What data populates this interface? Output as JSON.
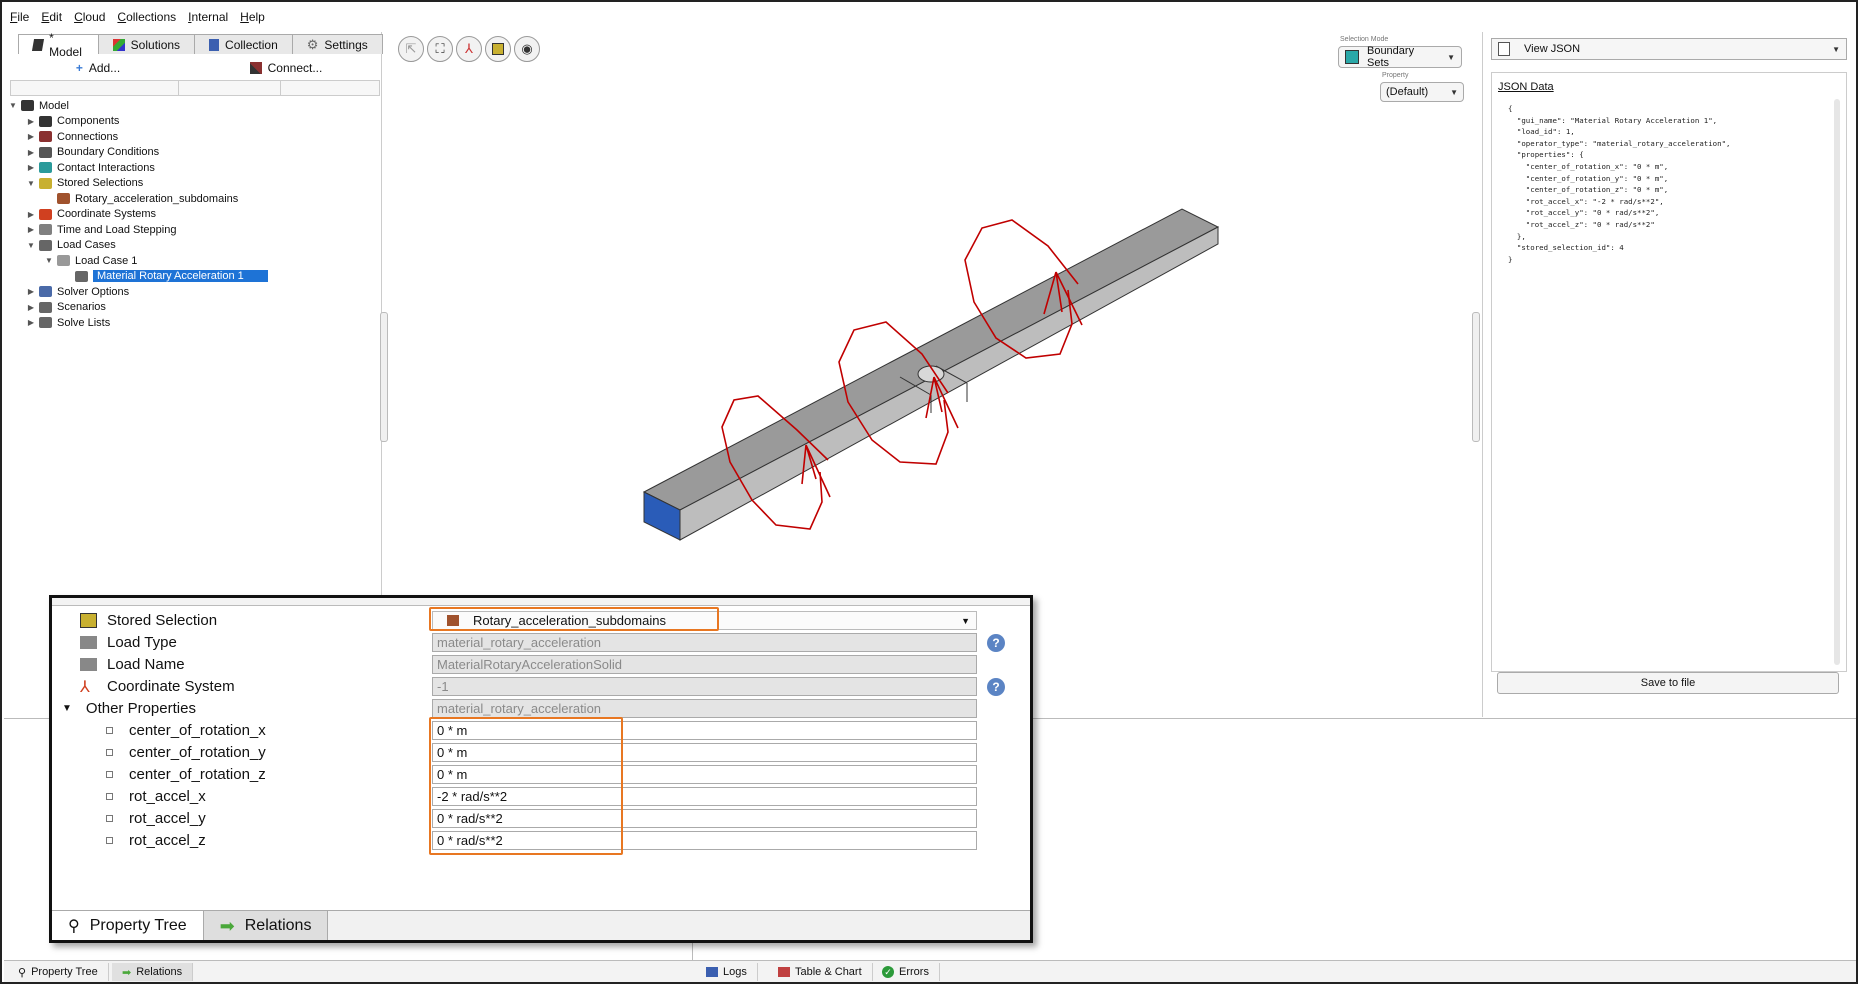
{
  "menu": [
    "File",
    "Edit",
    "Cloud",
    "Collections",
    "Internal",
    "Help"
  ],
  "tabs": [
    {
      "label": "* Model",
      "icon": "model-icon"
    },
    {
      "label": "Solutions",
      "icon": "solutions-icon"
    },
    {
      "label": "Collection",
      "icon": "collection-icon"
    },
    {
      "label": "Settings",
      "icon": "gear-icon"
    }
  ],
  "toolbar": {
    "add_label": "Add...",
    "connect_label": "Connect..."
  },
  "tree": [
    {
      "label": "Model",
      "indent": 0,
      "arrow": "▼",
      "color": "#333333"
    },
    {
      "label": "Components",
      "indent": 1,
      "arrow": "▶",
      "color": "#333333"
    },
    {
      "label": "Connections",
      "indent": 1,
      "arrow": "▶",
      "color": "#8a3030"
    },
    {
      "label": "Boundary Conditions",
      "indent": 1,
      "arrow": "▶",
      "color": "#555555"
    },
    {
      "label": "Contact Interactions",
      "indent": 1,
      "arrow": "▶",
      "color": "#2a9a9a"
    },
    {
      "label": "Stored Selections",
      "indent": 1,
      "arrow": "▼",
      "color": "#c8b030"
    },
    {
      "label": "Rotary_acceleration_subdomains",
      "indent": 2,
      "arrow": "",
      "color": "#a0522d"
    },
    {
      "label": "Coordinate Systems",
      "indent": 1,
      "arrow": "▶",
      "color": "#d04020"
    },
    {
      "label": "Time and Load Stepping",
      "indent": 1,
      "arrow": "▶",
      "color": "#808080"
    },
    {
      "label": "Load Cases",
      "indent": 1,
      "arrow": "▼",
      "color": "#666666"
    },
    {
      "label": "Load Case 1",
      "indent": 2,
      "arrow": "▼",
      "color": "#999999"
    },
    {
      "label": "Material Rotary Acceleration 1",
      "indent": 3,
      "arrow": "",
      "color": "#666666",
      "selected": true
    },
    {
      "label": "Solver Options",
      "indent": 1,
      "arrow": "▶",
      "color": "#4a6aa8"
    },
    {
      "label": "Scenarios",
      "indent": 1,
      "arrow": "▶",
      "color": "#666666"
    },
    {
      "label": "Solve Lists",
      "indent": 1,
      "arrow": "▶",
      "color": "#666666"
    }
  ],
  "viewport": {
    "selection_mode_label": "Selection Mode",
    "selection_mode_value": "Boundary Sets",
    "property_label": "Property",
    "property_value": "(Default)"
  },
  "right_panel": {
    "view_label": "View JSON",
    "json_title": "JSON Data",
    "json_text": "{\n  \"gui_name\": \"Material Rotary Acceleration 1\",\n  \"load_id\": 1,\n  \"operator_type\": \"material_rotary_acceleration\",\n  \"properties\": {\n    \"center_of_rotation_x\": \"0 * m\",\n    \"center_of_rotation_y\": \"0 * m\",\n    \"center_of_rotation_z\": \"0 * m\",\n    \"rot_accel_x\": \"-2 * rad/s**2\",\n    \"rot_accel_y\": \"0 * rad/s**2\",\n    \"rot_accel_z\": \"0 * rad/s**2\"\n  },\n  \"stored_selection_id\": 4\n}",
    "save_label": "Save to file"
  },
  "zoom": {
    "stored_selection_label": "Stored Selection",
    "stored_selection_value": "Rotary_acceleration_subdomains",
    "load_type_label": "Load Type",
    "load_type_value": "material_rotary_acceleration",
    "load_name_label": "Load Name",
    "load_name_value": "MaterialRotaryAccelerationSolid",
    "coord_label": "Coordinate System",
    "coord_value": "-1",
    "other_label": "Other Properties",
    "other_value": "material_rotary_acceleration",
    "props": [
      {
        "label": "center_of_rotation_x",
        "value": "0 * m"
      },
      {
        "label": "center_of_rotation_y",
        "value": "0 * m"
      },
      {
        "label": "center_of_rotation_z",
        "value": "0 * m"
      },
      {
        "label": "rot_accel_x",
        "value": "-2 * rad/s**2"
      },
      {
        "label": "rot_accel_y",
        "value": "0 * rad/s**2"
      },
      {
        "label": "rot_accel_z",
        "value": "0 * rad/s**2"
      }
    ],
    "tab_property_tree": "Property Tree",
    "tab_relations": "Relations"
  },
  "status": {
    "property_tree": "Property Tree",
    "relations": "Relations",
    "logs": "Logs",
    "table_chart": "Table & Chart",
    "errors": "Errors"
  },
  "colors": {
    "accent_orange": "#e87722",
    "selection_blue": "#1e73d6",
    "beam_gray": "#8c8c8c",
    "arrow_red": "#c00000"
  }
}
